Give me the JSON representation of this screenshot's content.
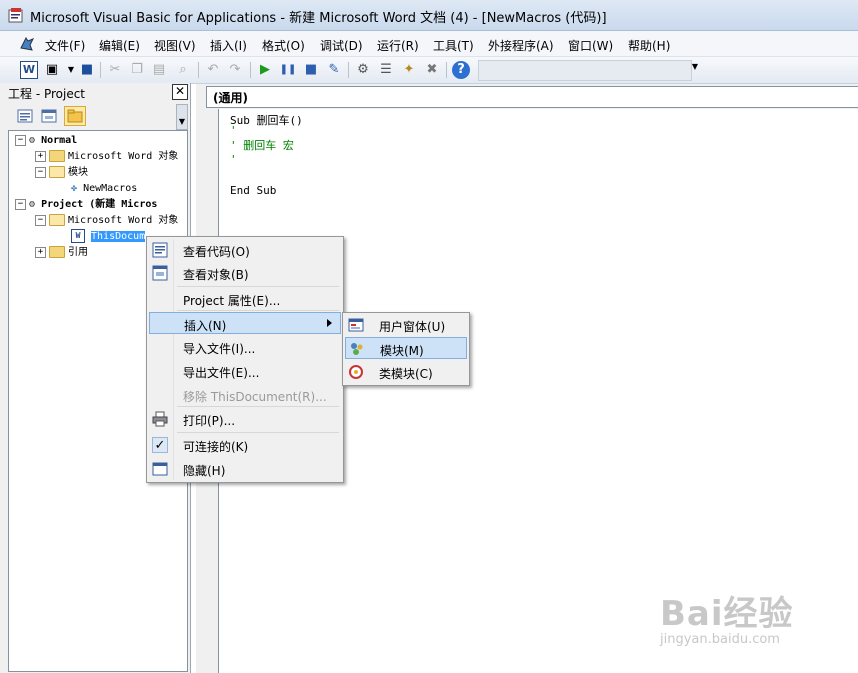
{
  "window": {
    "title": "Microsoft Visual Basic for Applications - 新建 Microsoft Word 文档 (4) - [NewMacros (代码)]"
  },
  "menubar": {
    "items": [
      "文件(F)",
      "编辑(E)",
      "视图(V)",
      "插入(I)",
      "格式(O)",
      "调试(D)",
      "运行(R)",
      "工具(T)",
      "外接程序(A)",
      "窗口(W)",
      "帮助(H)"
    ]
  },
  "project_panel": {
    "title": "工程 - Project",
    "close": "✕",
    "tree": {
      "normal": "Normal",
      "normal_word_objects": "Microsoft Word 对象",
      "normal_modules": "模块",
      "newmacros": "NewMacros",
      "project": "Project (新建 Micros",
      "project_word_objects": "Microsoft Word 对象",
      "thisdocument": "ThisDocum",
      "references": "引用"
    }
  },
  "code_window": {
    "procedure_combo": "(通用)",
    "lines": [
      "Sub 删回车()",
      "'",
      "' 删回车 宏",
      "'",
      "",
      "End Sub"
    ]
  },
  "context_menu": {
    "items": [
      {
        "label": "查看代码(O)",
        "icon": "view-code-icon"
      },
      {
        "label": "查看对象(B)",
        "icon": "view-object-icon"
      },
      {
        "label": "Project 属性(E)..."
      },
      {
        "label": "插入(N)"
      },
      {
        "label": "导入文件(I)..."
      },
      {
        "label": "导出文件(E)..."
      },
      {
        "label": "移除 ThisDocument(R)..."
      },
      {
        "label": "打印(P)...",
        "icon": "printer-icon"
      },
      {
        "label": "可连接的(K)",
        "icon": "checkmark-icon"
      },
      {
        "label": "隐藏(H)",
        "icon": "hide-icon"
      }
    ]
  },
  "submenu": {
    "items": [
      {
        "label": "用户窗体(U)",
        "icon": "userform-icon"
      },
      {
        "label": "模块(M)",
        "icon": "module-icon"
      },
      {
        "label": "类模块(C)",
        "icon": "class-module-icon"
      }
    ]
  },
  "watermark": {
    "brand": "Bai经验",
    "url": "jingyan.baidu.com"
  },
  "colors": {
    "selection": "#3399ff",
    "menu_highlight": "#cde2f7",
    "comment": "#008000"
  }
}
